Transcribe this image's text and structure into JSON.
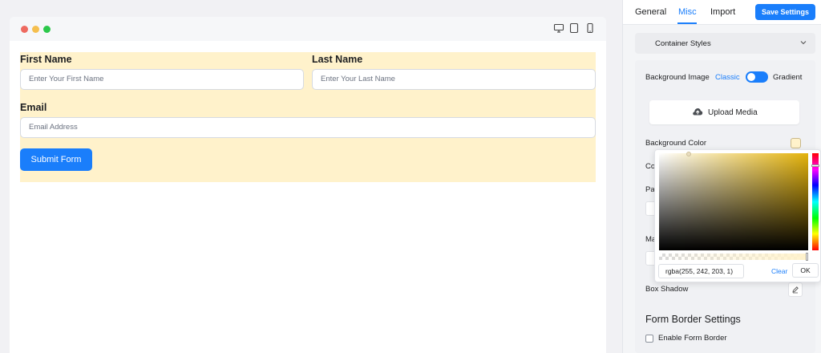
{
  "preview": {
    "form": {
      "first_name_label": "First Name",
      "first_name_placeholder": "Enter Your First Name",
      "last_name_label": "Last Name",
      "last_name_placeholder": "Enter Your Last Name",
      "email_label": "Email",
      "email_placeholder": "Email Address",
      "submit_label": "Submit Form"
    },
    "device_icons": [
      "desktop-icon",
      "tablet-icon",
      "mobile-icon"
    ]
  },
  "panel": {
    "tabs": [
      {
        "label": "General"
      },
      {
        "label": "Misc"
      },
      {
        "label": "Import"
      }
    ],
    "active_tab": "Misc",
    "save_label": "Save Settings",
    "section_title": "Container Styles",
    "background_image_label": "Background Image",
    "classic_label": "Classic",
    "gradient_label": "Gradient",
    "upload_label": "Upload Media",
    "background_color_label": "Background Color",
    "partial_labels": {
      "color": "Co",
      "padding": "Pa",
      "margin": "Ma"
    },
    "box_shadow_label": "Box Shadow",
    "border_section_title": "Form Border Settings",
    "enable_border_label": "Enable Form Border"
  },
  "color_picker": {
    "value": "rgba(255, 242, 203, 1)",
    "clear_label": "Clear",
    "ok_label": "OK"
  },
  "colors": {
    "accent": "#1a7efb",
    "form_background": "#fff2cb"
  }
}
